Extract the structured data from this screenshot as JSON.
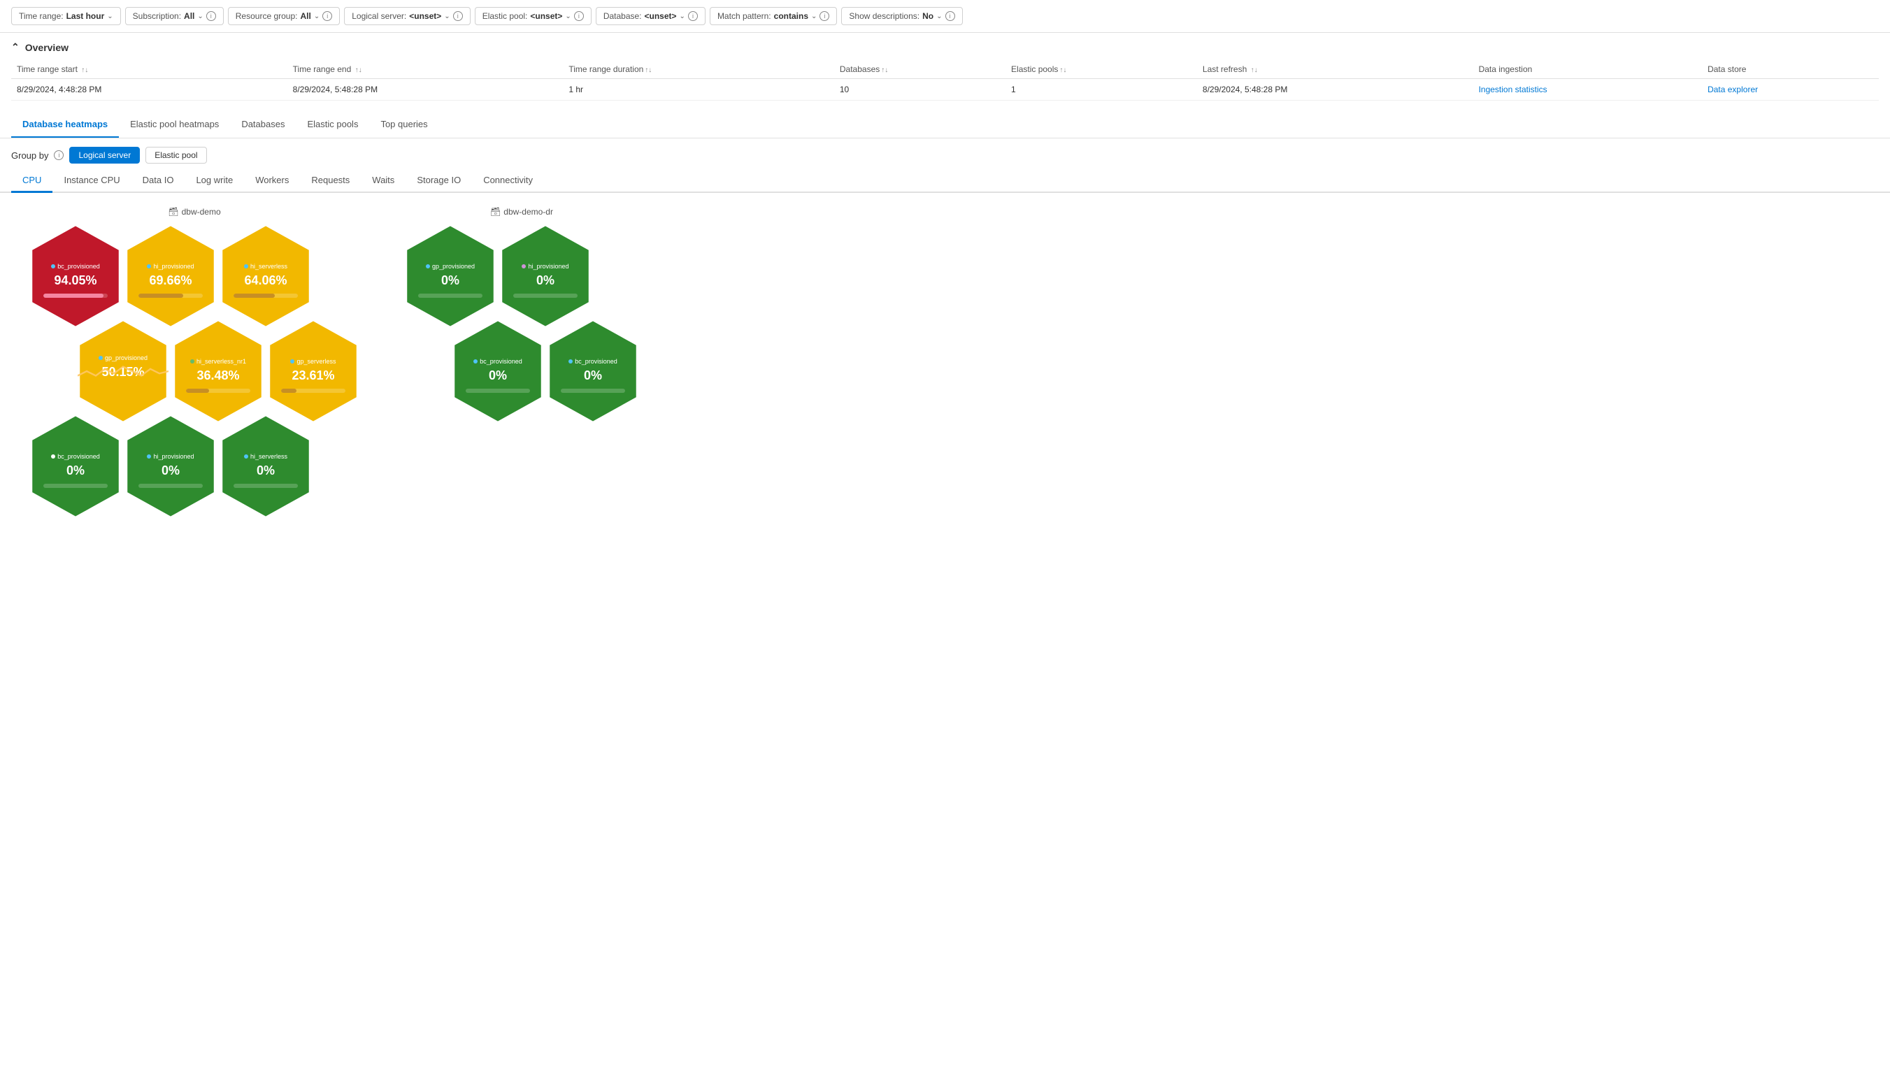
{
  "filterBar": {
    "timeRange": {
      "label": "Time range:",
      "value": "Last hour"
    },
    "subscription": {
      "label": "Subscription:",
      "value": "All"
    },
    "resourceGroup": {
      "label": "Resource group:",
      "value": "All"
    },
    "logicalServer": {
      "label": "Logical server:",
      "value": "<unset>"
    },
    "elasticPool": {
      "label": "Elastic pool:",
      "value": "<unset>"
    },
    "database": {
      "label": "Database:",
      "value": "<unset>"
    },
    "matchPattern": {
      "label": "Match pattern:",
      "value": "contains"
    },
    "showDescriptions": {
      "label": "Show descriptions:",
      "value": "No"
    }
  },
  "overview": {
    "title": "Overview",
    "table": {
      "headers": [
        {
          "label": "Time range start",
          "sortable": true
        },
        {
          "label": "Time range end",
          "sortable": true
        },
        {
          "label": "Time range duration",
          "sortable": true
        },
        {
          "label": "Databases",
          "sortable": true
        },
        {
          "label": "Elastic pools",
          "sortable": true
        },
        {
          "label": "Last refresh",
          "sortable": true
        },
        {
          "label": "Data ingestion",
          "sortable": false
        },
        {
          "label": "Data store",
          "sortable": false
        }
      ],
      "rows": [
        {
          "timeRangeStart": "8/29/2024, 4:48:28 PM",
          "timeRangeEnd": "8/29/2024, 5:48:28 PM",
          "duration": "1 hr",
          "databases": "10",
          "elasticPools": "1",
          "lastRefresh": "8/29/2024, 5:48:28 PM",
          "dataIngestion": "Ingestion statistics",
          "dataStore": "Data explorer"
        }
      ]
    }
  },
  "mainTabs": {
    "items": [
      {
        "label": "Database heatmaps",
        "active": true
      },
      {
        "label": "Elastic pool heatmaps",
        "active": false
      },
      {
        "label": "Databases",
        "active": false
      },
      {
        "label": "Elastic pools",
        "active": false
      },
      {
        "label": "Top queries",
        "active": false
      }
    ]
  },
  "groupBy": {
    "label": "Group by",
    "options": [
      {
        "label": "Logical server",
        "active": true
      },
      {
        "label": "Elastic pool",
        "active": false
      }
    ]
  },
  "subTabs": {
    "items": [
      {
        "label": "CPU",
        "active": true
      },
      {
        "label": "Instance CPU",
        "active": false
      },
      {
        "label": "Data IO",
        "active": false
      },
      {
        "label": "Log write",
        "active": false
      },
      {
        "label": "Workers",
        "active": false
      },
      {
        "label": "Requests",
        "active": false
      },
      {
        "label": "Waits",
        "active": false
      },
      {
        "label": "Storage IO",
        "active": false
      },
      {
        "label": "Connectivity",
        "active": false
      }
    ]
  },
  "clusters": [
    {
      "name": "dbw-demo",
      "icon": "server-icon",
      "rows": [
        {
          "offset": false,
          "cells": [
            {
              "name": "bc_provisioned",
              "value": "94.05%",
              "color": "red",
              "dot": "blue",
              "barWidth": 94,
              "barColor": "red",
              "sparkline": false
            },
            {
              "name": "hi_provisioned",
              "value": "69.66%",
              "color": "yellow",
              "dot": "blue",
              "barWidth": 70,
              "barColor": "yellow",
              "sparkline": false
            },
            {
              "name": "hi_serverless",
              "value": "64.06%",
              "color": "yellow",
              "dot": "blue",
              "barWidth": 64,
              "barColor": "yellow",
              "sparkline": false
            }
          ]
        },
        {
          "offset": true,
          "cells": [
            {
              "name": "gp_provisioned",
              "value": "50.15%",
              "color": "yellow",
              "dot": "blue",
              "barWidth": 50,
              "barColor": "yellow",
              "sparkline": true
            },
            {
              "name": "hi_serverless_nr1",
              "value": "36.48%",
              "color": "yellow",
              "dot": "green",
              "barWidth": 36,
              "barColor": "yellow",
              "sparkline": false
            },
            {
              "name": "gp_serverless",
              "value": "23.61%",
              "color": "yellow",
              "dot": "blue",
              "barWidth": 24,
              "barColor": "yellow",
              "sparkline": false
            }
          ]
        },
        {
          "offset": false,
          "cells": [
            {
              "name": "bc_provisioned",
              "value": "0%",
              "color": "green",
              "dot": "white",
              "barWidth": 0,
              "barColor": "green",
              "sparkline": false
            },
            {
              "name": "hi_provisioned",
              "value": "0%",
              "color": "green",
              "dot": "blue",
              "barWidth": 0,
              "barColor": "green",
              "sparkline": false
            },
            {
              "name": "hi_serverless",
              "value": "0%",
              "color": "green",
              "dot": "blue",
              "barWidth": 0,
              "barColor": "green",
              "sparkline": false
            }
          ]
        }
      ]
    },
    {
      "name": "dbw-demo-dr",
      "icon": "server-icon",
      "rows": [
        {
          "offset": false,
          "cells": [
            {
              "name": "gp_provisioned",
              "value": "0%",
              "color": "green",
              "dot": "blue",
              "barWidth": 0,
              "barColor": "green",
              "sparkline": false
            },
            {
              "name": "hi_provisioned",
              "value": "0%",
              "color": "green",
              "dot": "purple",
              "barWidth": 0,
              "barColor": "green",
              "sparkline": false
            }
          ]
        },
        {
          "offset": true,
          "cells": [
            {
              "name": "bc_provisioned",
              "value": "0%",
              "color": "green",
              "dot": "blue",
              "barWidth": 0,
              "barColor": "green",
              "sparkline": false
            },
            {
              "name": "bc_provisioned",
              "value": "0%",
              "color": "green",
              "dot": "blue",
              "barWidth": 0,
              "barColor": "green",
              "sparkline": false
            }
          ]
        }
      ]
    }
  ]
}
